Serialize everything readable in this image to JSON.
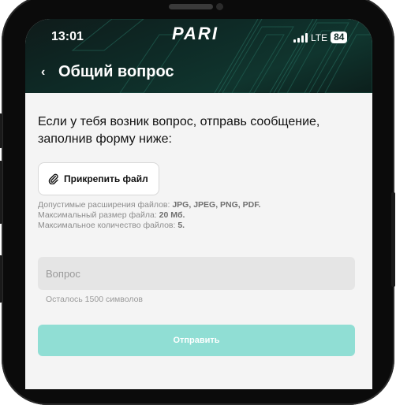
{
  "status_bar": {
    "time": "13:01",
    "network": "LTE",
    "battery": "84"
  },
  "app": {
    "logo": "PARI"
  },
  "header": {
    "title": "Общий вопрос",
    "back_icon": "chevron-left-icon"
  },
  "form": {
    "intro": "Если у тебя возник вопрос, отправь сообщение, заполнив форму ниже:",
    "attach_label": "Прикрепить файл",
    "attach_icon": "paperclip-icon",
    "hints": {
      "extensions_label": "Допустимые расширения файлов: ",
      "extensions_value": "JPG, JPEG, PNG, PDF.",
      "max_size_label": "Максимальный размер файла: ",
      "max_size_value": "20 Мб.",
      "max_count_label": "Максимальное количество файлов: ",
      "max_count_value": "5."
    },
    "question_placeholder": "Вопрос",
    "question_value": "",
    "counter": "Осталось 1500 символов",
    "submit_label": "Отправить"
  },
  "colors": {
    "header_bg": "#0e2a26",
    "submit_disabled": "#90ded4",
    "input_bg": "#e5e5e5"
  }
}
